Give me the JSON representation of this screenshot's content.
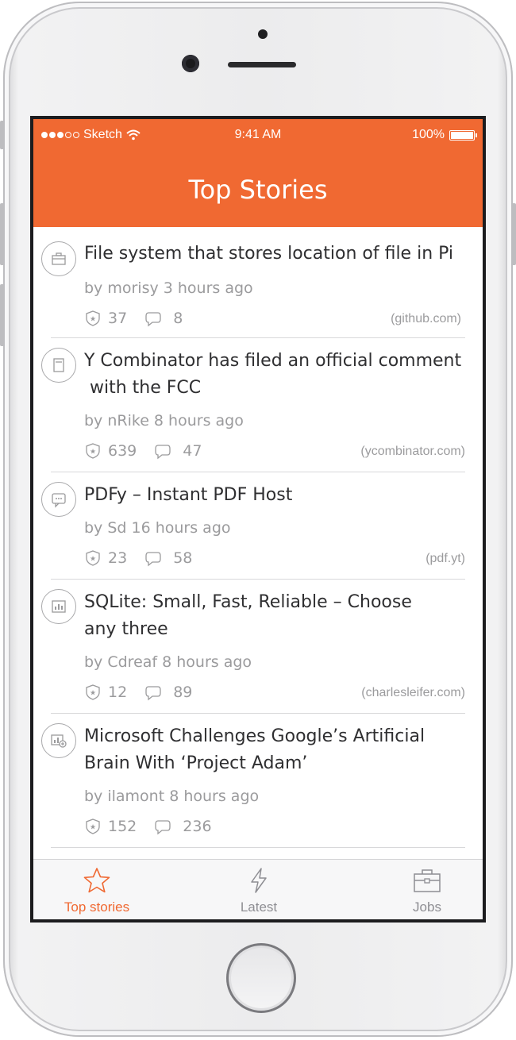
{
  "status_bar": {
    "carrier": "Sketch",
    "time": "9:41 AM",
    "battery": "100%"
  },
  "navbar": {
    "title": "Top Stories"
  },
  "stories": [
    {
      "icon": "briefcase-icon",
      "title_line1": "File system that stores location of file in Pi",
      "title_line2": "",
      "meta": "by morisy 3 hours ago",
      "points": "37",
      "comments": "8",
      "domain": "(github.com)"
    },
    {
      "icon": "document-icon",
      "title_line1": "Y Combinator has filed an official comment",
      "title_line2": " with the FCC",
      "meta": "by nRike 8 hours ago",
      "points": "639",
      "comments": "47",
      "domain": "(ycombinator.com)"
    },
    {
      "icon": "chat-icon",
      "title_line1": "PDFy – Instant PDF Host",
      "title_line2": "",
      "meta": "by Sd 16 hours ago",
      "points": "23",
      "comments": "58",
      "domain": "(pdf.yt)"
    },
    {
      "icon": "chart-icon",
      "title_line1": "SQLite: Small, Fast, Reliable – Choose",
      "title_line2": "any three",
      "meta": "by Cdreaf 8 hours ago",
      "points": "12",
      "comments": "89",
      "domain": "(charlesleifer.com)"
    },
    {
      "icon": "chart-plus-icon",
      "title_line1": "Microsoft Challenges Google’s Artificial",
      "title_line2": "Brain With ‘Project Adam’",
      "meta": "by ilamont 8 hours ago",
      "points": "152",
      "comments": "236",
      "domain": ""
    }
  ],
  "tabs": [
    {
      "label": "Top stories",
      "icon": "star-icon",
      "active": true
    },
    {
      "label": "Latest",
      "icon": "lightning-icon",
      "active": false
    },
    {
      "label": "Jobs",
      "icon": "toolbox-icon",
      "active": false
    }
  ],
  "colors": {
    "accent": "#f06932",
    "text": "#2f2f31",
    "muted": "#9b9b9d"
  }
}
